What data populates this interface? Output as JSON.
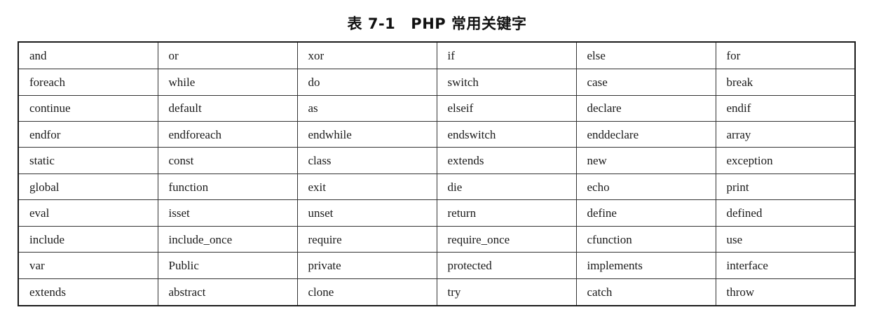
{
  "caption": {
    "number": "表 7-1",
    "title": "PHP 常用关键字"
  },
  "table": {
    "rows": [
      [
        "and",
        "or",
        "xor",
        "if",
        "else",
        "for"
      ],
      [
        "foreach",
        "while",
        "do",
        "switch",
        "case",
        "break"
      ],
      [
        "continue",
        "default",
        "as",
        "elseif",
        "declare",
        "endif"
      ],
      [
        "endfor",
        "endforeach",
        "endwhile",
        "endswitch",
        "enddeclare",
        "array"
      ],
      [
        "static",
        "const",
        "class",
        "extends",
        "new",
        "exception"
      ],
      [
        "global",
        "function",
        "exit",
        "die",
        "echo",
        "print"
      ],
      [
        "eval",
        "isset",
        "unset",
        "return",
        "define",
        "defined"
      ],
      [
        "include",
        "include_once",
        "require",
        "require_once",
        "cfunction",
        "use"
      ],
      [
        "var",
        "Public",
        "private",
        "protected",
        "implements",
        "interface"
      ],
      [
        "extends",
        "abstract",
        "clone",
        "try",
        "catch",
        "throw"
      ]
    ]
  }
}
